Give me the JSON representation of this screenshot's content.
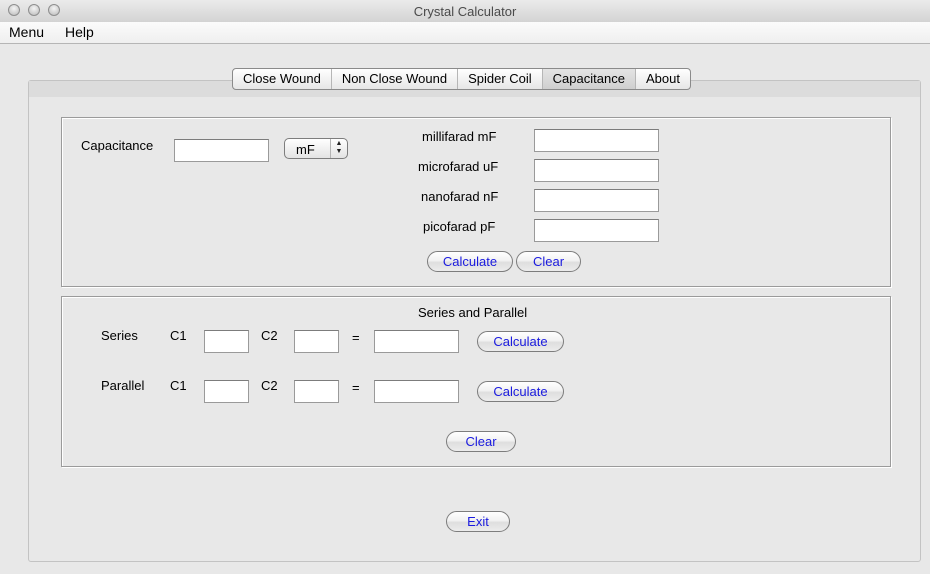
{
  "window": {
    "title": "Crystal Calculator"
  },
  "menubar": {
    "items": [
      "Menu",
      "Help"
    ]
  },
  "tabs": [
    {
      "label": "Close Wound",
      "active": false
    },
    {
      "label": "Non Close Wound",
      "active": false
    },
    {
      "label": "Spider Coil",
      "active": false
    },
    {
      "label": "Capacitance",
      "active": true
    },
    {
      "label": "About",
      "active": false
    }
  ],
  "converter": {
    "capacitance_label": "Capacitance",
    "capacitance_value": "",
    "unit_selected": "mF",
    "rows": [
      {
        "label": "millifarad mF",
        "value": ""
      },
      {
        "label": "microfarad uF",
        "value": ""
      },
      {
        "label": "nanofarad nF",
        "value": ""
      },
      {
        "label": "picofarad pF",
        "value": ""
      }
    ],
    "calculate_label": "Calculate",
    "clear_label": "Clear"
  },
  "series_parallel": {
    "title": "Series and Parallel",
    "series": {
      "label": "Series",
      "c1_label": "C1",
      "c2_label": "C2",
      "equals": "=",
      "c1_value": "",
      "c2_value": "",
      "result": "",
      "calculate_label": "Calculate"
    },
    "parallel": {
      "label": "Parallel",
      "c1_label": "C1",
      "c2_label": "C2",
      "equals": "=",
      "c1_value": "",
      "c2_value": "",
      "result": "",
      "calculate_label": "Calculate"
    },
    "clear_label": "Clear"
  },
  "exit_label": "Exit"
}
